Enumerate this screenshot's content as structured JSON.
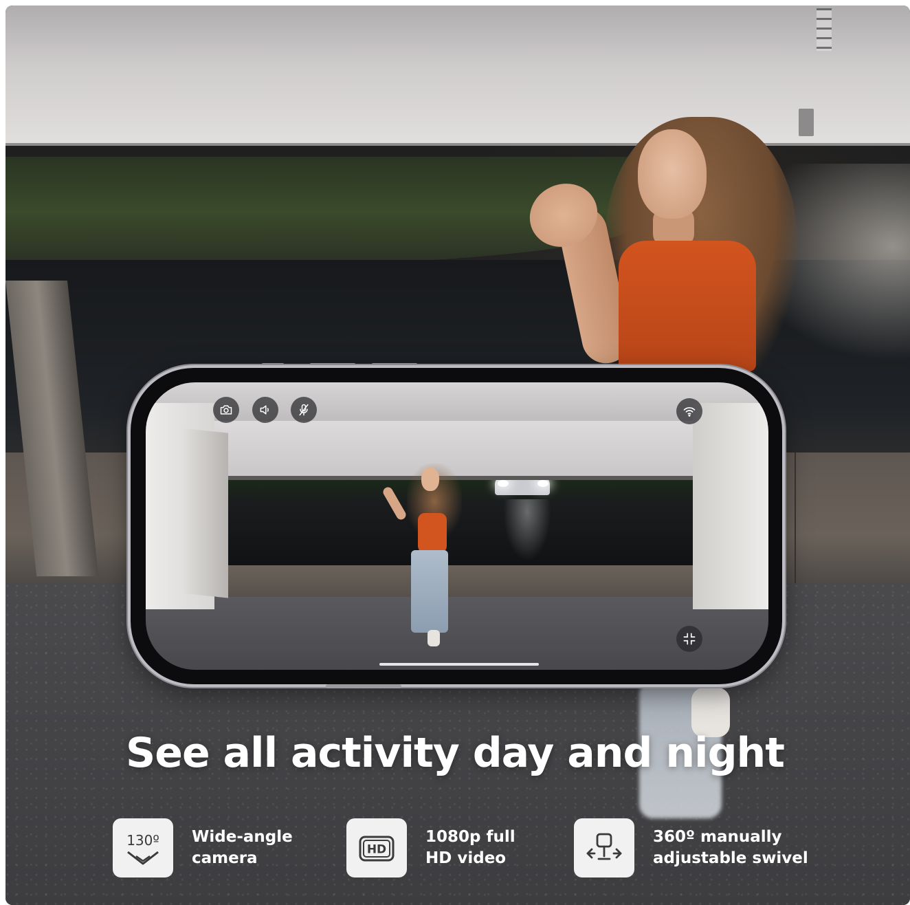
{
  "headline": "See all activity day and night",
  "phone_controls": {
    "left": [
      "camera-icon",
      "speaker-icon",
      "mic-muted-icon"
    ],
    "right": "wifi-icon",
    "bottom_right": "exit-fullscreen-icon"
  },
  "features": [
    {
      "icon": "wide-angle-icon",
      "icon_text": "130º",
      "line1": "Wide-angle",
      "line2": "camera"
    },
    {
      "icon": "hd-icon",
      "icon_text": "HD",
      "line1": "1080p full",
      "line2": "HD video"
    },
    {
      "icon": "swivel-camera-icon",
      "icon_text": "",
      "line1": "360º manually",
      "line2": "adjustable swivel"
    }
  ],
  "colors": {
    "text": "#ffffff",
    "feature_tile": "#f1f1f1",
    "icon_stroke": "#3a3a3a",
    "phone_frame": "#bdbcc2"
  }
}
